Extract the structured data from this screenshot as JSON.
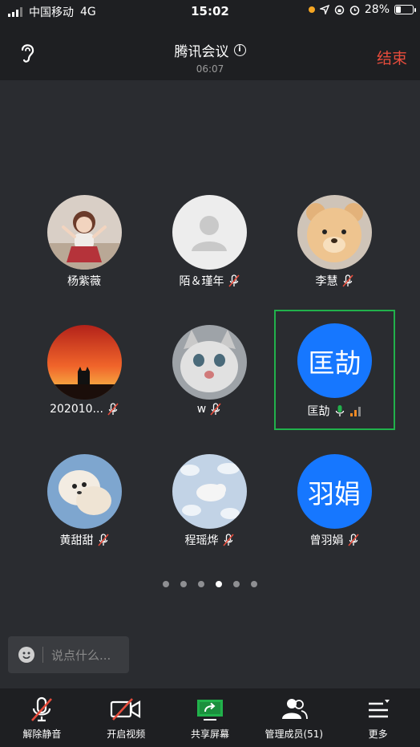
{
  "status_bar": {
    "carrier": "中国移动",
    "network": "4G",
    "time": "15:02",
    "battery": "28%",
    "battery_level": 0.28
  },
  "header": {
    "title": "腾讯会议",
    "elapsed": "06:07",
    "end_label": "结束"
  },
  "participants": [
    {
      "name": "杨紫薇"
    },
    {
      "name": "陌＆瑾年"
    },
    {
      "name": "李慧"
    },
    {
      "name": "202010..."
    },
    {
      "name": "w"
    },
    {
      "name": "匡劼",
      "avatar_text": "匡劼",
      "speaking": true
    },
    {
      "name": "黄甜甜"
    },
    {
      "name": "程瑶烨"
    },
    {
      "name": "曾羽娟",
      "avatar_text": "羽娟"
    }
  ],
  "pager": {
    "total": 6,
    "active": 4
  },
  "chat": {
    "placeholder": "说点什么..."
  },
  "toolbar": {
    "unmute": "解除静音",
    "video": "开启视频",
    "share": "共享屏幕",
    "members": "管理成员(51)",
    "more": "更多"
  },
  "colors": {
    "end": "#e74c3c",
    "speaking_border": "#21b14b",
    "avatar_blue": "#1677ff",
    "share_green": "#21b14b"
  }
}
